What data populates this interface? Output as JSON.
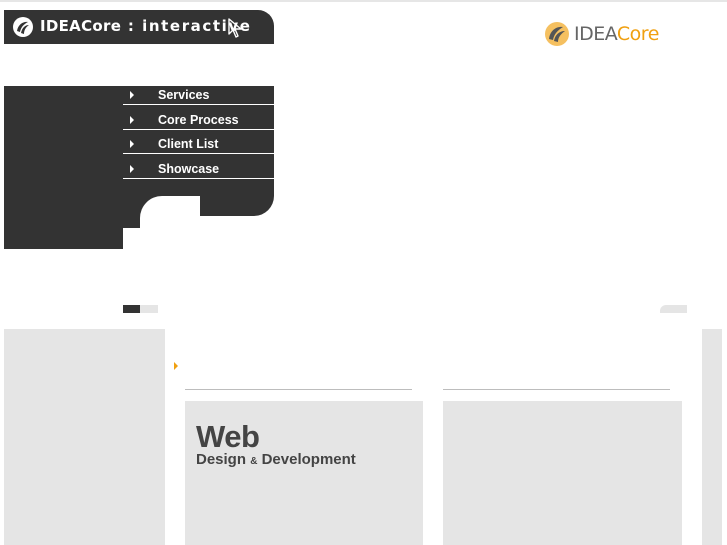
{
  "header": {
    "brand_name": "IDEACore",
    "separator": " : ",
    "section": "interactive"
  },
  "brand_logo": {
    "text_part1": "IDEA",
    "text_part2": "Core",
    "colors": {
      "gray": "#666666",
      "orange": "#f0a010"
    }
  },
  "menu": {
    "items": [
      {
        "label": "Services"
      },
      {
        "label": "Core Process"
      },
      {
        "label": "Client List"
      },
      {
        "label": "Showcase"
      }
    ]
  },
  "content": {
    "card1": {
      "title": "Web",
      "subtitle_part1": "Design",
      "subtitle_amp": "&",
      "subtitle_part2": "Development"
    }
  },
  "colors": {
    "dark": "#333333",
    "light_gray": "#e5e5e5",
    "accent": "#f0a010"
  },
  "icons": [
    "ideacore-logo-icon",
    "cursor-arrow-icon",
    "menu-arrow-icon",
    "bullet-arrow-icon"
  ]
}
